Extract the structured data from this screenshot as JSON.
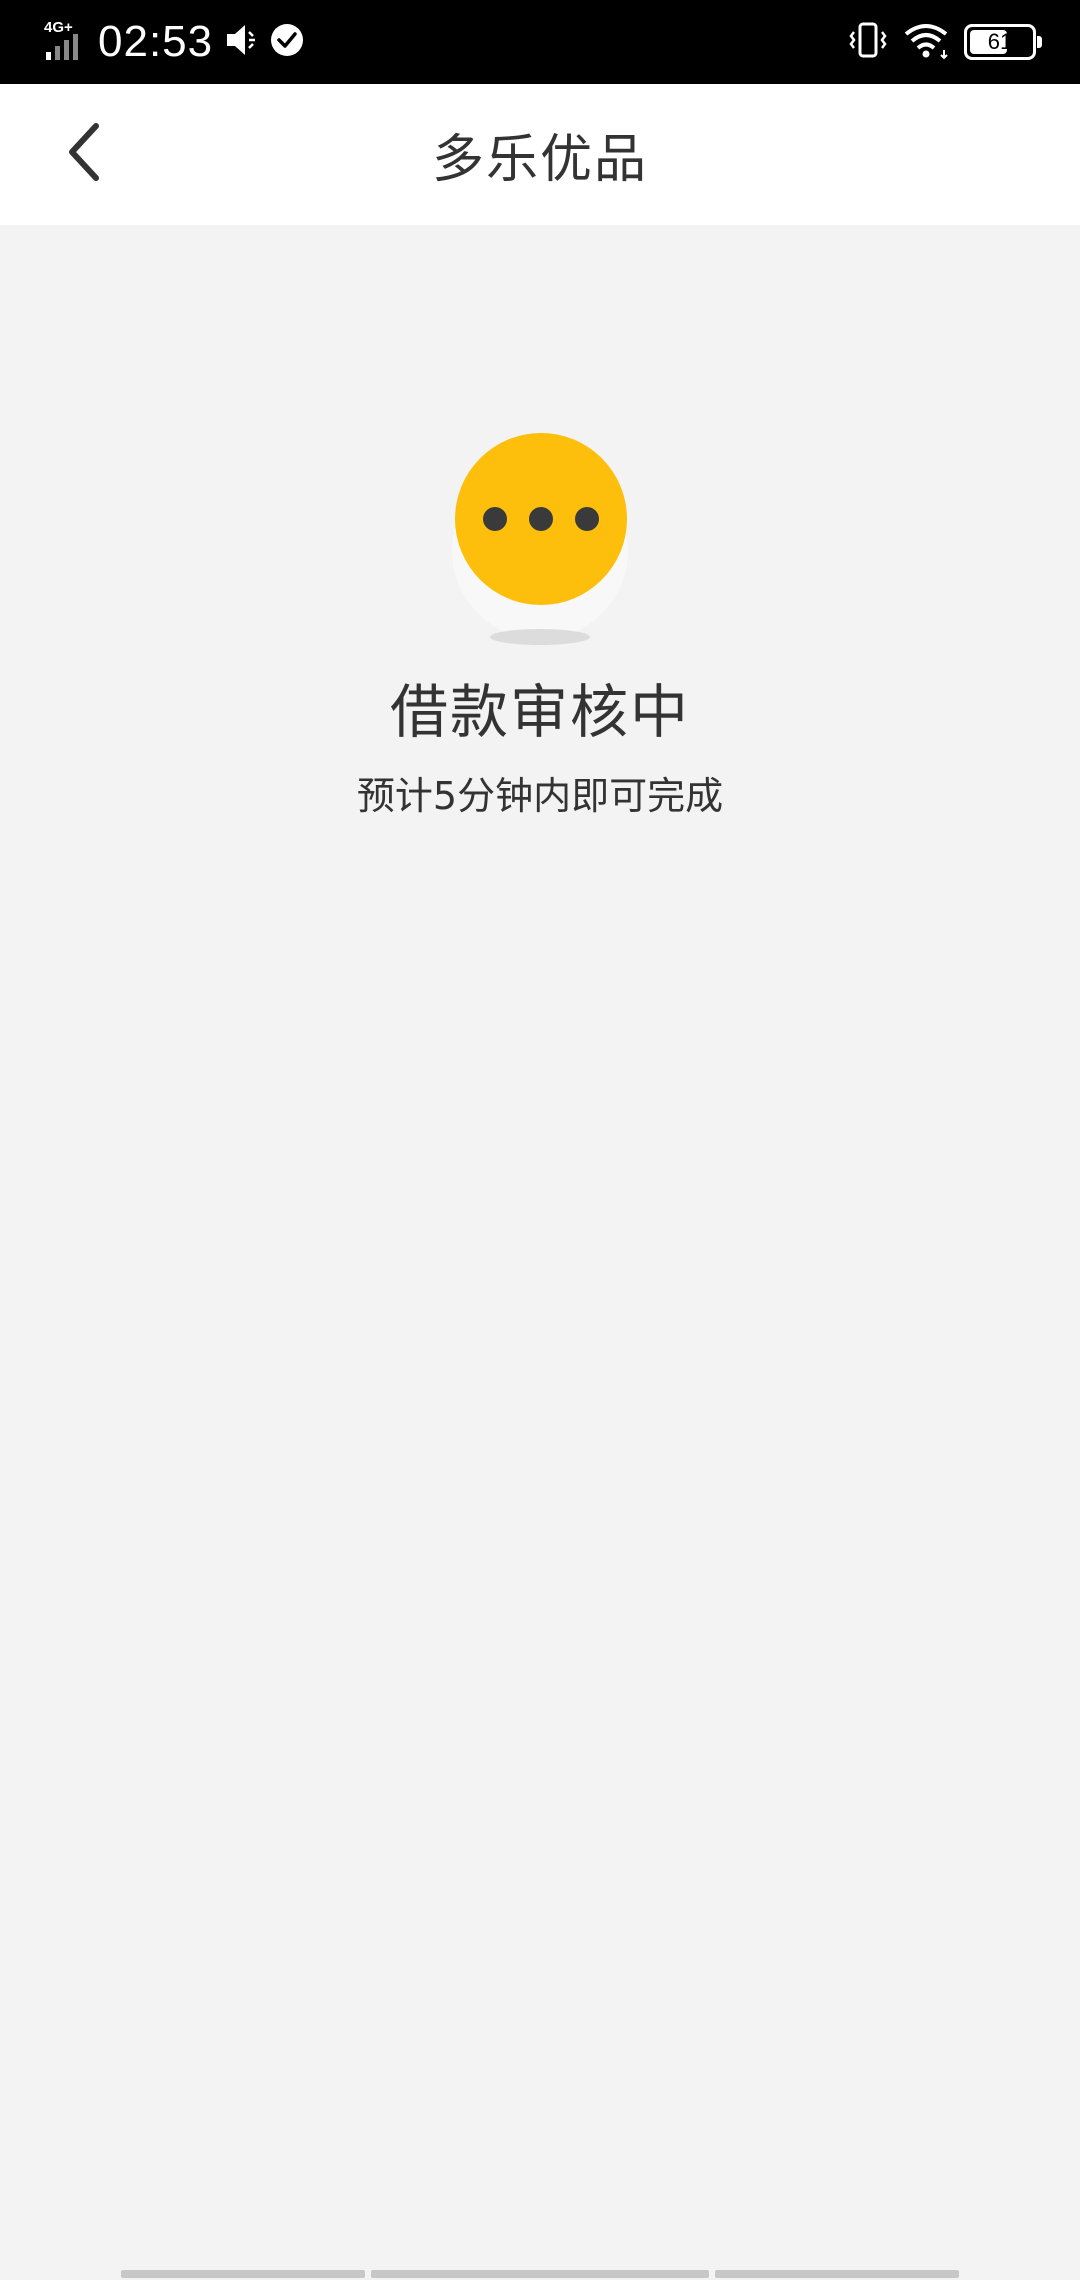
{
  "status_bar": {
    "network": "4G+",
    "time": "02:53",
    "battery": "61",
    "battery_level": 0.61
  },
  "header": {
    "title": "多乐优品"
  },
  "status": {
    "title": "借款审核中",
    "subtitle": "预计5分钟内即可完成",
    "icon": "pending-dots-icon",
    "accent_color": "#FDBF0C"
  }
}
